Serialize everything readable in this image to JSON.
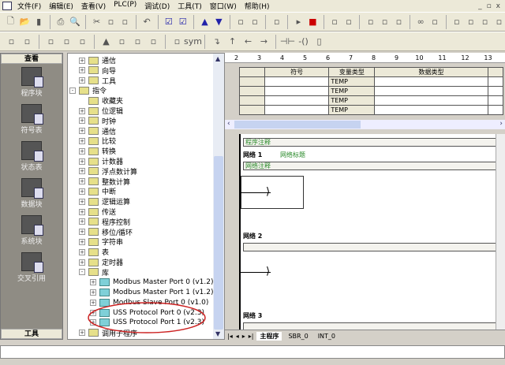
{
  "menu": [
    "文件(F)",
    "编辑(E)",
    "查看(V)",
    "PLC(P)",
    "调试(D)",
    "工具(T)",
    "窗口(W)",
    "帮助(H)"
  ],
  "window_controls": [
    "_",
    "▫",
    "x"
  ],
  "nav": {
    "header": "查看",
    "footer": "工具",
    "items": [
      "程序块",
      "符号表",
      "状态表",
      "数据块",
      "系统块",
      "交叉引用"
    ]
  },
  "tree": [
    {
      "label": "通信",
      "level": 0,
      "exp": "+"
    },
    {
      "label": "向导",
      "level": 0,
      "exp": "+"
    },
    {
      "label": "工具",
      "level": 0,
      "exp": "+"
    },
    {
      "label": "指令",
      "level": -1,
      "exp": "-"
    },
    {
      "label": "收藏夹",
      "level": 0,
      "exp": ""
    },
    {
      "label": "位逻辑",
      "level": 0,
      "exp": "+"
    },
    {
      "label": "时钟",
      "level": 0,
      "exp": "+"
    },
    {
      "label": "通信",
      "level": 0,
      "exp": "+"
    },
    {
      "label": "比较",
      "level": 0,
      "exp": "+"
    },
    {
      "label": "转换",
      "level": 0,
      "exp": "+"
    },
    {
      "label": "计数器",
      "level": 0,
      "exp": "+"
    },
    {
      "label": "浮点数计算",
      "level": 0,
      "exp": "+"
    },
    {
      "label": "整数计算",
      "level": 0,
      "exp": "+"
    },
    {
      "label": "中断",
      "level": 0,
      "exp": "+"
    },
    {
      "label": "逻辑运算",
      "level": 0,
      "exp": "+"
    },
    {
      "label": "传送",
      "level": 0,
      "exp": "+"
    },
    {
      "label": "程序控制",
      "level": 0,
      "exp": "+"
    },
    {
      "label": "移位/循环",
      "level": 0,
      "exp": "+"
    },
    {
      "label": "字符串",
      "level": 0,
      "exp": "+"
    },
    {
      "label": "表",
      "level": 0,
      "exp": "+"
    },
    {
      "label": "定时器",
      "level": 0,
      "exp": "+"
    },
    {
      "label": "库",
      "level": 0,
      "exp": "-"
    },
    {
      "label": "Modbus Master Port 0 (v1.2)",
      "level": 1,
      "exp": "+"
    },
    {
      "label": "Modbus Master Port 1 (v1.2)",
      "level": 1,
      "exp": "+"
    },
    {
      "label": "Modbus Slave Port 0 (v1.0)",
      "level": 1,
      "exp": "+"
    },
    {
      "label": "USS Protocol Port 0 (v2.3)",
      "level": 1,
      "exp": "+"
    },
    {
      "label": "USS Protocol Port 1 (v2.3)",
      "level": 1,
      "exp": "+"
    },
    {
      "label": "调用子程序",
      "level": 0,
      "exp": "+"
    }
  ],
  "highlight_color": "#cc2222",
  "ruler": [
    "2",
    "3",
    "4",
    "5",
    "6",
    "7",
    "8",
    "9",
    "10",
    "11",
    "12",
    "13"
  ],
  "vartable": {
    "headers": [
      "",
      "符号",
      "变量类型",
      "数据类型",
      ""
    ],
    "rows": [
      "TEMP",
      "TEMP",
      "TEMP",
      "TEMP"
    ]
  },
  "ladder": {
    "program_comment": "程序注释",
    "networks": [
      {
        "label": "网络 1",
        "title": "网络标题",
        "comment": "网络注释"
      },
      {
        "label": "网络 2"
      },
      {
        "label": "网络 3"
      }
    ]
  },
  "tabs": [
    "主程序",
    "SBR_0",
    "INT_0"
  ]
}
